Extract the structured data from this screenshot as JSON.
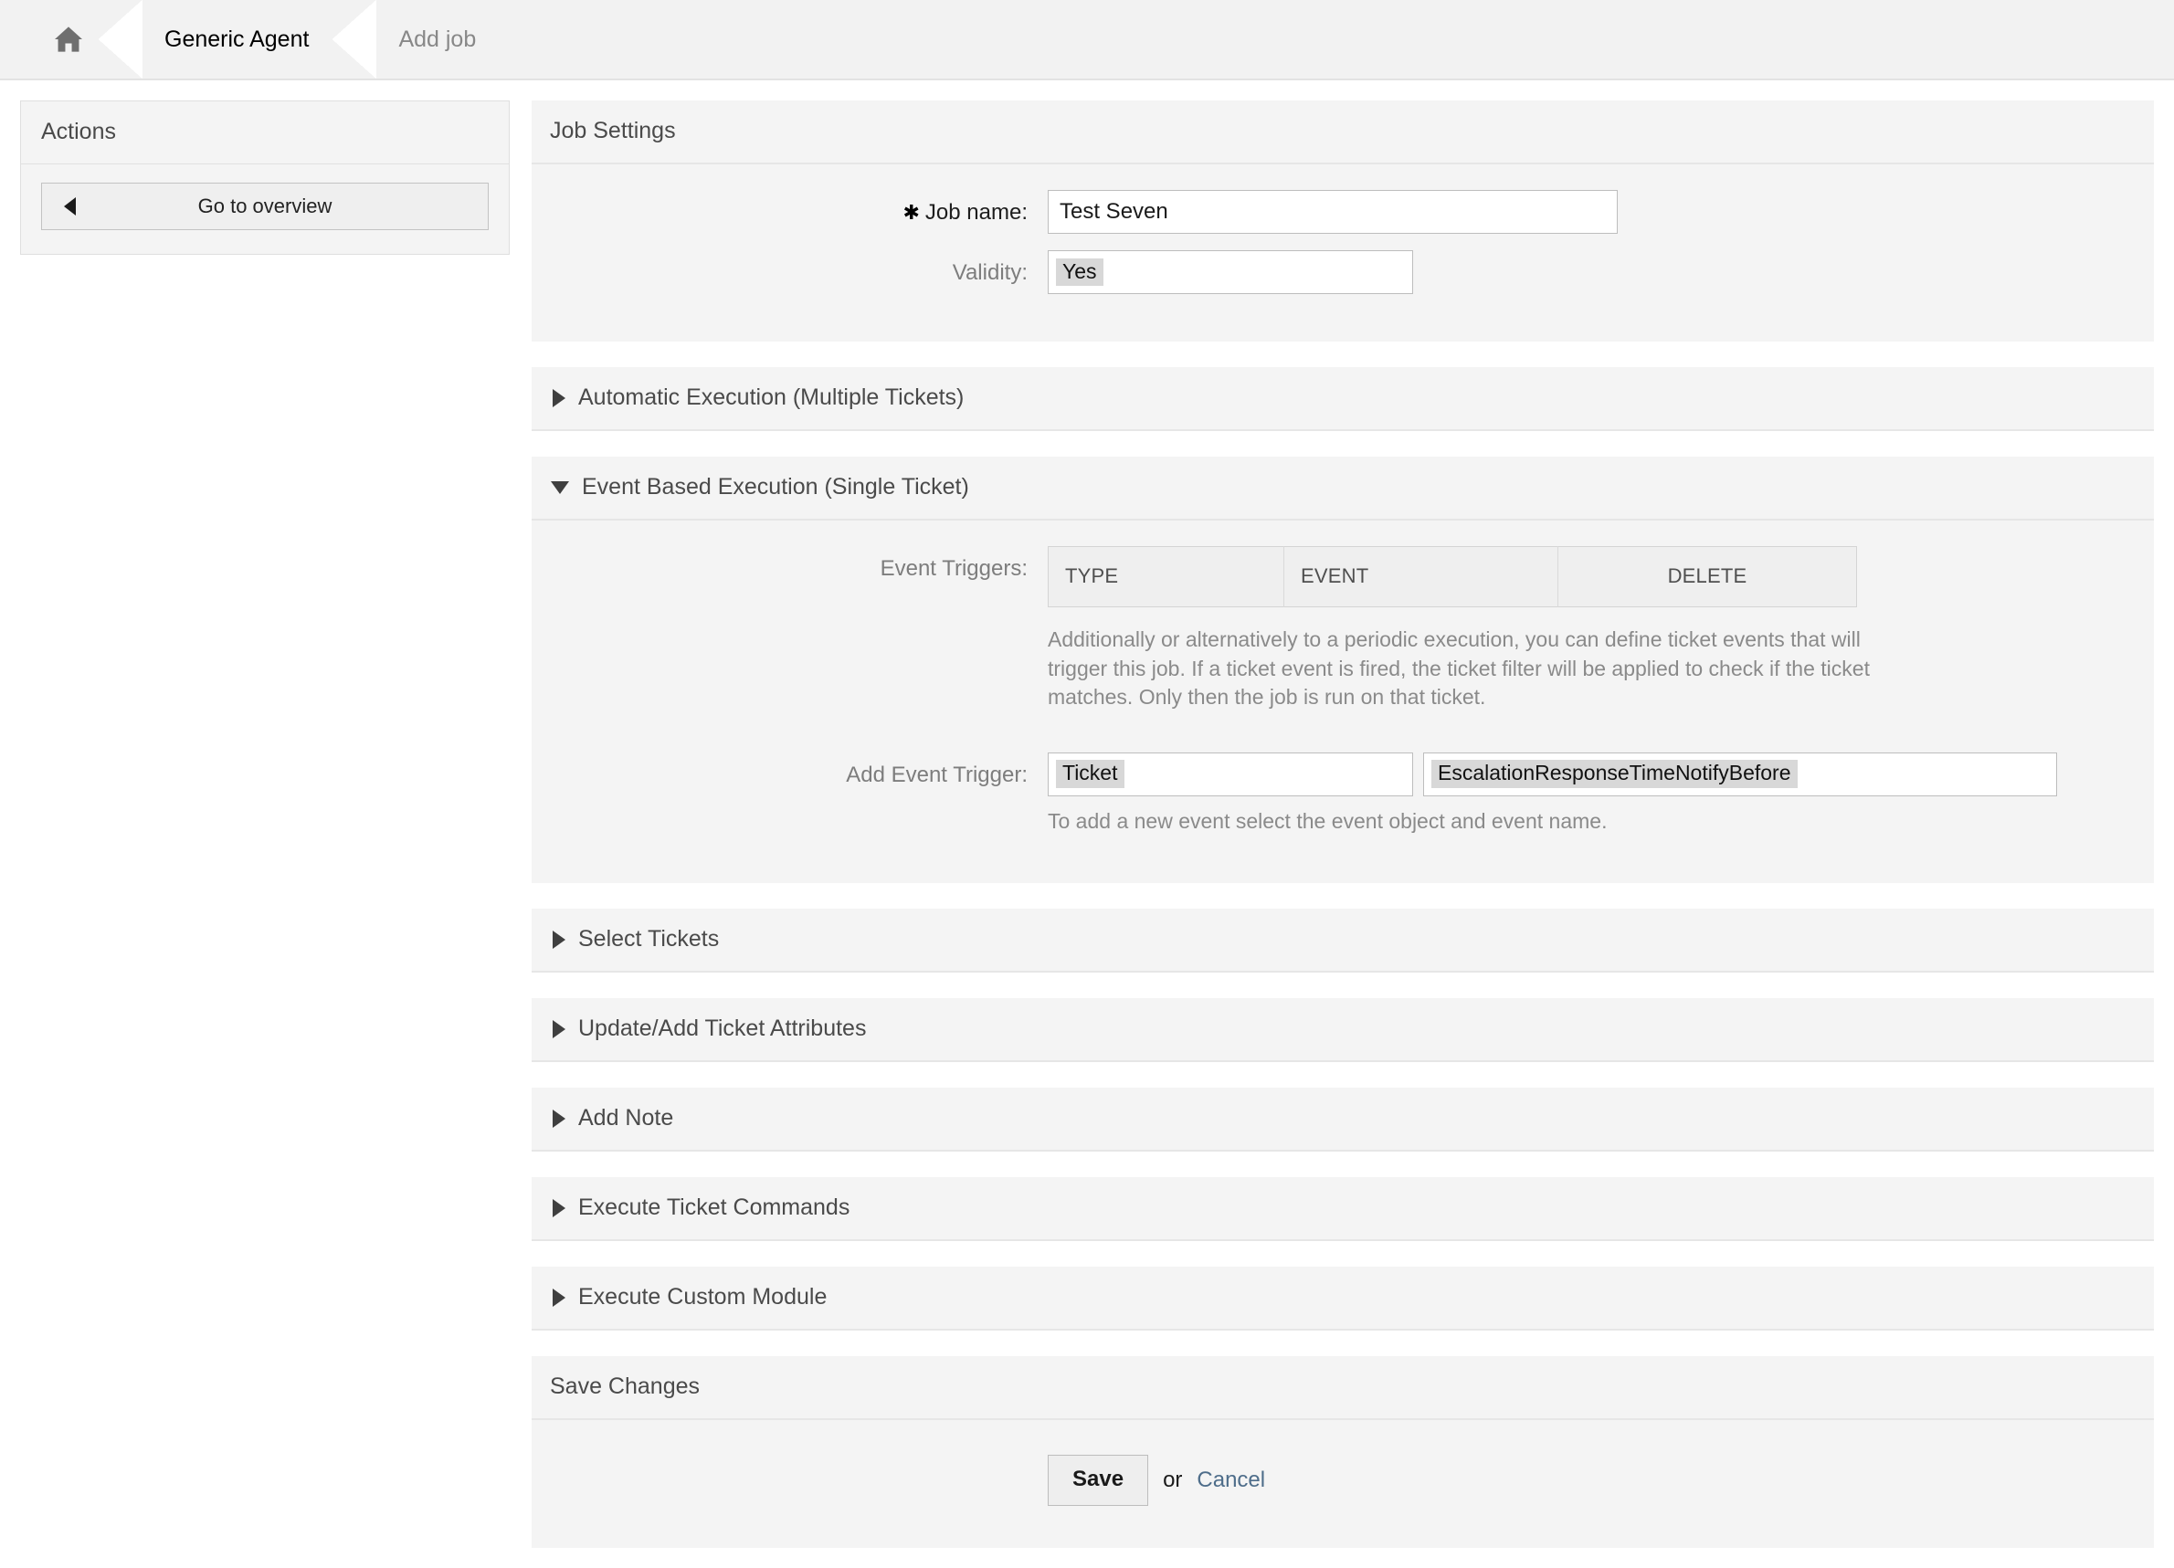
{
  "breadcrumb": {
    "home_icon": "home-icon",
    "items": [
      {
        "label": "Generic Agent",
        "current": true
      },
      {
        "label": "Add job",
        "current": false
      }
    ]
  },
  "sidebar": {
    "actions_title": "Actions",
    "go_to_overview_label": "Go to overview",
    "back_icon": "caret-left-icon"
  },
  "main": {
    "job_settings": {
      "title": "Job Settings",
      "job_name_label": "Job name:",
      "required_marker": "✱",
      "job_name_value": "Test Seven",
      "validity_label": "Validity:",
      "validity_value": "Yes"
    },
    "sections": {
      "automatic_execution": "Automatic Execution (Multiple Tickets)",
      "event_based_execution": "Event Based Execution (Single Ticket)",
      "select_tickets": "Select Tickets",
      "update_add_ticket_attributes": "Update/Add Ticket Attributes",
      "add_note": "Add Note",
      "execute_ticket_commands": "Execute Ticket Commands",
      "execute_custom_module": "Execute Custom Module",
      "save_changes": "Save Changes"
    },
    "event_based": {
      "event_triggers_label": "Event Triggers:",
      "table_headers": [
        "TYPE",
        "EVENT",
        "DELETE"
      ],
      "table_rows": [],
      "triggers_hint": "Additionally or alternatively to a periodic execution, you can define ticket events that will trigger this job. If a ticket event is fired, the ticket filter will be applied to check if the ticket matches. Only then the job is run on that ticket.",
      "add_event_trigger_label": "Add Event Trigger:",
      "object_value": "Ticket",
      "event_value": "EscalationResponseTimeNotifyBefore",
      "add_hint": "To add a new event select the event object and event name."
    },
    "save_area": {
      "save_label": "Save",
      "or_label": "or",
      "cancel_label": "Cancel"
    }
  },
  "colors": {
    "panel_bg": "#f4f4f4",
    "page_bg": "#ffffff",
    "link": "#4e6d8a",
    "muted_text": "#8a8a8a"
  }
}
